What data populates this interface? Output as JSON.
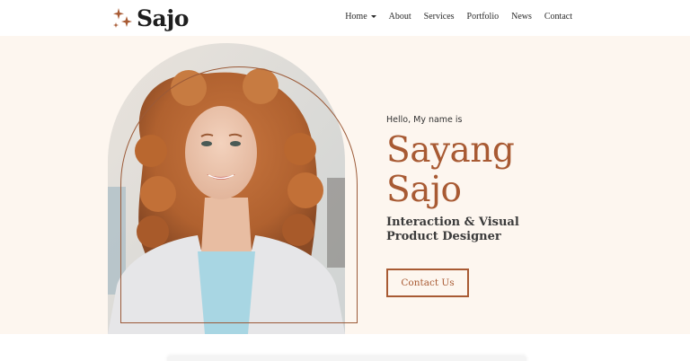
{
  "brand": {
    "name": "Sajo",
    "accent_color": "#a85a33",
    "logo_icon": "sparkles-icon"
  },
  "nav": {
    "items": [
      {
        "label": "Home",
        "has_dropdown": true
      },
      {
        "label": "About",
        "has_dropdown": false
      },
      {
        "label": "Services",
        "has_dropdown": false
      },
      {
        "label": "Portfolio",
        "has_dropdown": false
      },
      {
        "label": "News",
        "has_dropdown": false
      },
      {
        "label": "Contact",
        "has_dropdown": false
      }
    ]
  },
  "hero": {
    "greeting": "Hello, My name is",
    "first_name": "Sayang",
    "last_name": "Sajo",
    "role": "Interaction & Visual Product Designer",
    "cta_label": "Contact Us",
    "background_color": "#fdf6ef"
  }
}
